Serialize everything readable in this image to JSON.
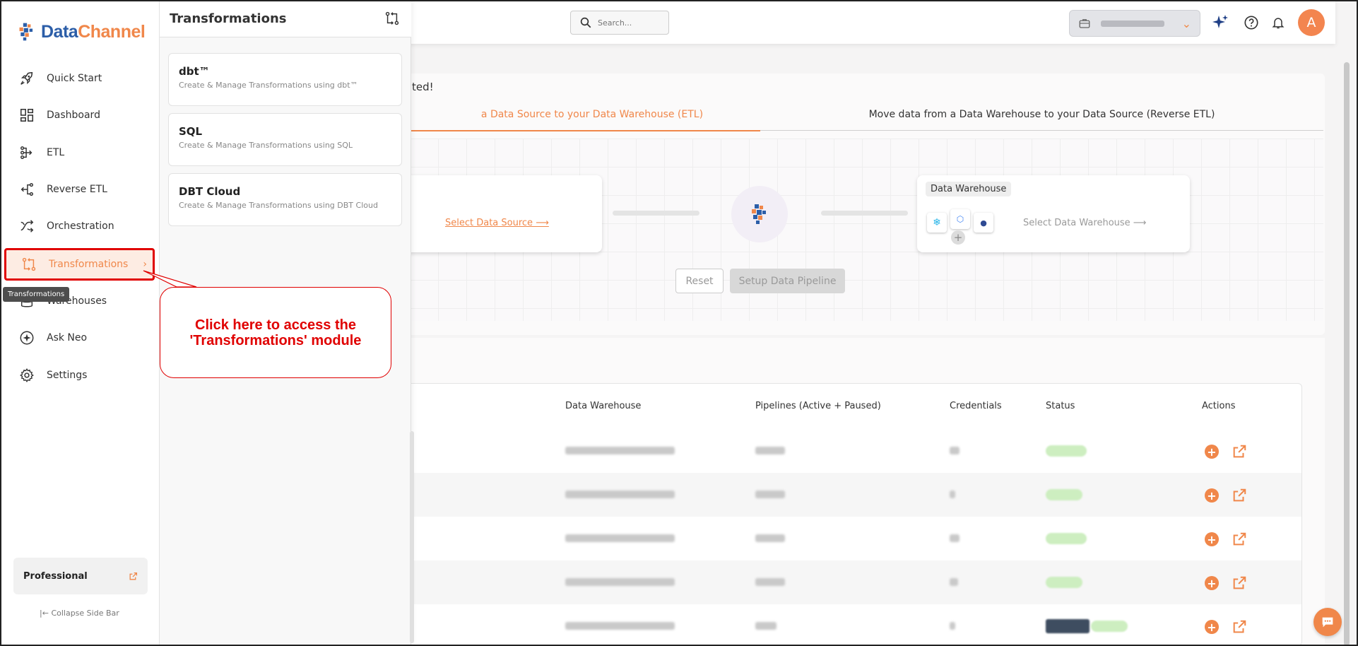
{
  "app": {
    "brand_data": "Data",
    "brand_channel": "Channel",
    "brand_color": "#2c5ea8",
    "accent_color": "#f0874a"
  },
  "sidebar": {
    "items": [
      {
        "label": "Quick Start",
        "icon": "rocket-icon"
      },
      {
        "label": "Dashboard",
        "icon": "dashboard-icon"
      },
      {
        "label": "ETL",
        "icon": "etl-icon"
      },
      {
        "label": "Reverse ETL",
        "icon": "reverse-etl-icon"
      },
      {
        "label": "Orchestration",
        "icon": "orchestration-icon"
      },
      {
        "label": "Transformations",
        "icon": "transformations-icon",
        "active": true
      },
      {
        "label": "Warehouses",
        "icon": "warehouse-icon"
      },
      {
        "label": "Ask Neo",
        "icon": "sparkle-icon"
      },
      {
        "label": "Settings",
        "icon": "gear-icon"
      }
    ],
    "tooltip": "Transformations",
    "plan": "Professional",
    "collapse": "Collapse Side Bar"
  },
  "flyout": {
    "title": "Transformations",
    "cards": [
      {
        "title": "dbt™",
        "desc": "Create & Manage Transformations using dbt™"
      },
      {
        "title": "SQL",
        "desc": "Create & Manage Transformations using SQL"
      },
      {
        "title": "DBT Cloud",
        "desc": "Create & Manage Transformations using DBT Cloud"
      }
    ]
  },
  "callout": {
    "line1": "Click here to access the",
    "line2": "'Transformations' module",
    "color": "#e00000"
  },
  "topbar": {
    "search_placeholder": "Search...",
    "avatar": "A"
  },
  "main": {
    "welcome_suffix": "ted!",
    "tab_etl": "a Data Source to your Data Warehouse (ETL)",
    "tab_reverse": "Move data from a Data Warehouse to your Data Source (Reverse ETL)",
    "select_source": "Select Data Source ⟶",
    "warehouse_tag": "Data Warehouse",
    "select_warehouse": "Select Data Warehouse ⟶",
    "reset": "Reset",
    "setup": "Setup Data Pipeline"
  },
  "table": {
    "headers": [
      "Data Warehouse",
      "Pipelines (Active + Paused)",
      "Credentials",
      "Status",
      "Actions"
    ]
  }
}
